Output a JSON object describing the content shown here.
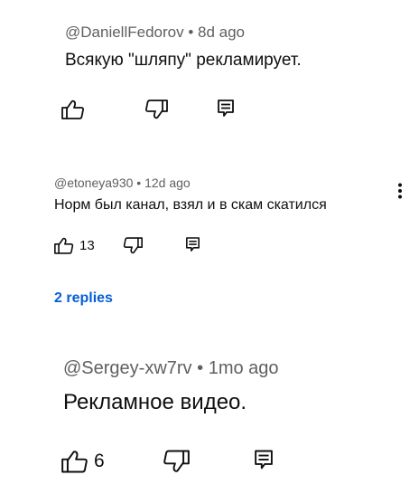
{
  "comments": [
    {
      "author": "@DaniellFedorov",
      "separator": "•",
      "time": "8d ago",
      "text": "Всякую \"шляпу\" рекламирует.",
      "likes": "",
      "like_icon": "thumb-up-icon",
      "dislike_icon": "thumb-down-icon",
      "reply_icon": "reply-icon"
    },
    {
      "author": "@etoneya930",
      "separator": "•",
      "time": "12d ago",
      "text": "Норм был канал, взял и в скам скатился",
      "likes": "13",
      "like_icon": "thumb-up-icon",
      "dislike_icon": "thumb-down-icon",
      "reply_icon": "reply-icon",
      "more_icon": "more-vertical-icon",
      "replies_label": "2 replies"
    },
    {
      "author": "@Sergey-xw7rv",
      "separator": "•",
      "time": "1mo ago",
      "text": "Рекламное видео.",
      "likes": "6",
      "like_icon": "thumb-up-icon",
      "dislike_icon": "thumb-down-icon",
      "reply_icon": "reply-icon"
    }
  ],
  "colors": {
    "meta": "#606060",
    "text": "#0f0f0f",
    "link": "#065fd4",
    "background": "#ffffff"
  }
}
